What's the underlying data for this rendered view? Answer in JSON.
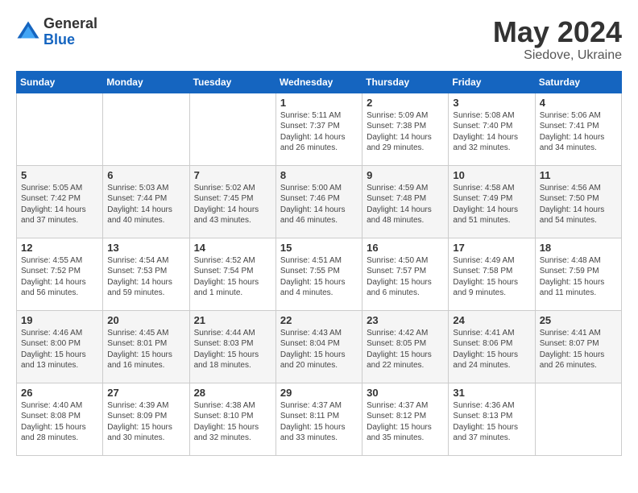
{
  "logo": {
    "general": "General",
    "blue": "Blue"
  },
  "title": "May 2024",
  "location": "Siedove, Ukraine",
  "days_of_week": [
    "Sunday",
    "Monday",
    "Tuesday",
    "Wednesday",
    "Thursday",
    "Friday",
    "Saturday"
  ],
  "weeks": [
    [
      {
        "day": "",
        "info": ""
      },
      {
        "day": "",
        "info": ""
      },
      {
        "day": "",
        "info": ""
      },
      {
        "day": "1",
        "info": "Sunrise: 5:11 AM\nSunset: 7:37 PM\nDaylight: 14 hours\nand 26 minutes."
      },
      {
        "day": "2",
        "info": "Sunrise: 5:09 AM\nSunset: 7:38 PM\nDaylight: 14 hours\nand 29 minutes."
      },
      {
        "day": "3",
        "info": "Sunrise: 5:08 AM\nSunset: 7:40 PM\nDaylight: 14 hours\nand 32 minutes."
      },
      {
        "day": "4",
        "info": "Sunrise: 5:06 AM\nSunset: 7:41 PM\nDaylight: 14 hours\nand 34 minutes."
      }
    ],
    [
      {
        "day": "5",
        "info": "Sunrise: 5:05 AM\nSunset: 7:42 PM\nDaylight: 14 hours\nand 37 minutes."
      },
      {
        "day": "6",
        "info": "Sunrise: 5:03 AM\nSunset: 7:44 PM\nDaylight: 14 hours\nand 40 minutes."
      },
      {
        "day": "7",
        "info": "Sunrise: 5:02 AM\nSunset: 7:45 PM\nDaylight: 14 hours\nand 43 minutes."
      },
      {
        "day": "8",
        "info": "Sunrise: 5:00 AM\nSunset: 7:46 PM\nDaylight: 14 hours\nand 46 minutes."
      },
      {
        "day": "9",
        "info": "Sunrise: 4:59 AM\nSunset: 7:48 PM\nDaylight: 14 hours\nand 48 minutes."
      },
      {
        "day": "10",
        "info": "Sunrise: 4:58 AM\nSunset: 7:49 PM\nDaylight: 14 hours\nand 51 minutes."
      },
      {
        "day": "11",
        "info": "Sunrise: 4:56 AM\nSunset: 7:50 PM\nDaylight: 14 hours\nand 54 minutes."
      }
    ],
    [
      {
        "day": "12",
        "info": "Sunrise: 4:55 AM\nSunset: 7:52 PM\nDaylight: 14 hours\nand 56 minutes."
      },
      {
        "day": "13",
        "info": "Sunrise: 4:54 AM\nSunset: 7:53 PM\nDaylight: 14 hours\nand 59 minutes."
      },
      {
        "day": "14",
        "info": "Sunrise: 4:52 AM\nSunset: 7:54 PM\nDaylight: 15 hours\nand 1 minute."
      },
      {
        "day": "15",
        "info": "Sunrise: 4:51 AM\nSunset: 7:55 PM\nDaylight: 15 hours\nand 4 minutes."
      },
      {
        "day": "16",
        "info": "Sunrise: 4:50 AM\nSunset: 7:57 PM\nDaylight: 15 hours\nand 6 minutes."
      },
      {
        "day": "17",
        "info": "Sunrise: 4:49 AM\nSunset: 7:58 PM\nDaylight: 15 hours\nand 9 minutes."
      },
      {
        "day": "18",
        "info": "Sunrise: 4:48 AM\nSunset: 7:59 PM\nDaylight: 15 hours\nand 11 minutes."
      }
    ],
    [
      {
        "day": "19",
        "info": "Sunrise: 4:46 AM\nSunset: 8:00 PM\nDaylight: 15 hours\nand 13 minutes."
      },
      {
        "day": "20",
        "info": "Sunrise: 4:45 AM\nSunset: 8:01 PM\nDaylight: 15 hours\nand 16 minutes."
      },
      {
        "day": "21",
        "info": "Sunrise: 4:44 AM\nSunset: 8:03 PM\nDaylight: 15 hours\nand 18 minutes."
      },
      {
        "day": "22",
        "info": "Sunrise: 4:43 AM\nSunset: 8:04 PM\nDaylight: 15 hours\nand 20 minutes."
      },
      {
        "day": "23",
        "info": "Sunrise: 4:42 AM\nSunset: 8:05 PM\nDaylight: 15 hours\nand 22 minutes."
      },
      {
        "day": "24",
        "info": "Sunrise: 4:41 AM\nSunset: 8:06 PM\nDaylight: 15 hours\nand 24 minutes."
      },
      {
        "day": "25",
        "info": "Sunrise: 4:41 AM\nSunset: 8:07 PM\nDaylight: 15 hours\nand 26 minutes."
      }
    ],
    [
      {
        "day": "26",
        "info": "Sunrise: 4:40 AM\nSunset: 8:08 PM\nDaylight: 15 hours\nand 28 minutes."
      },
      {
        "day": "27",
        "info": "Sunrise: 4:39 AM\nSunset: 8:09 PM\nDaylight: 15 hours\nand 30 minutes."
      },
      {
        "day": "28",
        "info": "Sunrise: 4:38 AM\nSunset: 8:10 PM\nDaylight: 15 hours\nand 32 minutes."
      },
      {
        "day": "29",
        "info": "Sunrise: 4:37 AM\nSunset: 8:11 PM\nDaylight: 15 hours\nand 33 minutes."
      },
      {
        "day": "30",
        "info": "Sunrise: 4:37 AM\nSunset: 8:12 PM\nDaylight: 15 hours\nand 35 minutes."
      },
      {
        "day": "31",
        "info": "Sunrise: 4:36 AM\nSunset: 8:13 PM\nDaylight: 15 hours\nand 37 minutes."
      },
      {
        "day": "",
        "info": ""
      }
    ]
  ]
}
